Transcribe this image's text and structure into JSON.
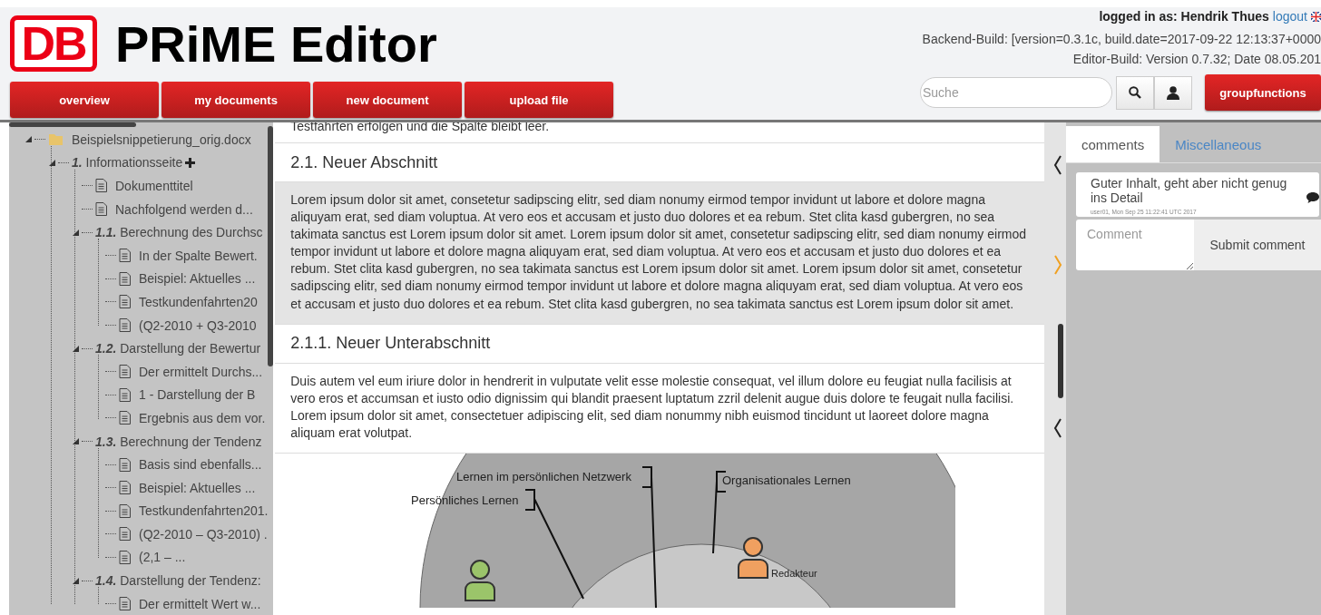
{
  "header": {
    "logo": "DB",
    "title": "PRiME Editor",
    "user_label": "logged in as: Hendrik Thues",
    "logout": "logout",
    "backend_build": "Backend-Build: [version=0.3.1c, build.date=2017-09-22 12:13:37+0000",
    "editor_build": "Editor-Build: Version 0.7.32; Date 08.05.201"
  },
  "nav": [
    {
      "label": "overview"
    },
    {
      "label": "my documents"
    },
    {
      "label": "new document"
    },
    {
      "label": "upload file"
    }
  ],
  "search": {
    "placeholder": "Suche"
  },
  "group_button": "groupfunctions",
  "tree": [
    {
      "kind": "file",
      "label": "Beispielsnippetierung_orig.docx",
      "expanded": true,
      "children": [
        {
          "kind": "section",
          "number": "1.",
          "label": "Informationsseite",
          "expanded": true,
          "children": [
            {
              "kind": "doc",
              "label": "Dokumenttitel"
            },
            {
              "kind": "doc",
              "label": "Nachfolgend werden d..."
            },
            {
              "kind": "section",
              "number": "1.1.",
              "label": "Berechnung des Durchsc",
              "expanded": true,
              "children": [
                {
                  "kind": "doc",
                  "label": "In der Spalte Bewert."
                },
                {
                  "kind": "doc",
                  "label": "Beispiel: Aktuelles ..."
                },
                {
                  "kind": "doc",
                  "label": "Testkundenfahrten20"
                },
                {
                  "kind": "doc",
                  "label": "(Q2-2010 + Q3-2010"
                }
              ]
            },
            {
              "kind": "section",
              "number": "1.2.",
              "label": "Darstellung der Bewertur",
              "expanded": true,
              "children": [
                {
                  "kind": "doc",
                  "label": "Der ermittelt Durchs..."
                },
                {
                  "kind": "doc",
                  "label": " 1 - Darstellung der B"
                },
                {
                  "kind": "doc",
                  "label": "Ergebnis aus dem vor."
                }
              ]
            },
            {
              "kind": "section",
              "number": "1.3.",
              "label": "Berechnung der Tendenz",
              "expanded": true,
              "children": [
                {
                  "kind": "doc",
                  "label": "Basis sind ebenfalls..."
                },
                {
                  "kind": "doc",
                  "label": "Beispiel: Aktuelles ..."
                },
                {
                  "kind": "doc",
                  "label": "Testkundenfahrten201."
                },
                {
                  "kind": "doc",
                  "label": "(Q2-2010 – Q3-2010) ."
                },
                {
                  "kind": "doc",
                  "label": "(2,1 – ..."
                }
              ]
            },
            {
              "kind": "section",
              "number": "1.4.",
              "label": "Darstellung der Tendenz:",
              "expanded": true,
              "children": [
                {
                  "kind": "doc",
                  "label": "Der ermittelt Wert w..."
                }
              ]
            }
          ]
        }
      ]
    }
  ],
  "content": {
    "cut_text": "Testfahrten erfolgen und die Spalte bleibt leer.",
    "blocks": [
      {
        "kind": "heading",
        "text": "2.1. Neuer Abschnitt",
        "selected": false
      },
      {
        "kind": "paragraph",
        "selected": true,
        "text": "Lorem ipsum dolor sit amet, consetetur sadipscing elitr, sed diam nonumy eirmod tempor invidunt ut labore et dolore magna aliquyam erat, sed diam voluptua. At vero eos et accusam et justo duo dolores et ea rebum. Stet clita kasd gubergren, no sea takimata sanctus est Lorem ipsum dolor sit amet. Lorem ipsum dolor sit amet, consetetur sadipscing elitr, sed diam nonumy eirmod tempor invidunt ut labore et dolore magna aliquyam erat, sed diam voluptua. At vero eos et accusam et justo duo dolores et ea rebum. Stet clita kasd gubergren, no sea takimata sanctus est Lorem ipsum dolor sit amet. Lorem ipsum dolor sit amet, consetetur sadipscing elitr, sed diam nonumy eirmod tempor invidunt ut labore et dolore magna aliquyam erat, sed diam voluptua. At vero eos et accusam et justo duo dolores et ea rebum. Stet clita kasd gubergren, no sea takimata sanctus est Lorem ipsum dolor sit amet."
      },
      {
        "kind": "heading",
        "text": "2.1.1. Neuer Unterabschnitt",
        "selected": false
      },
      {
        "kind": "paragraph",
        "selected": false,
        "text": "Duis autem vel eum iriure dolor in hendrerit in vulputate velit esse molestie consequat, vel illum dolore eu feugiat nulla facilisis at vero eros et accumsan et iusto odio dignissim qui blandit praesent luptatum zzril delenit augue duis dolore te feugait nulla facilisi. Lorem ipsum dolor sit amet, consectetuer adipiscing elit, sed diam nonummy nibh euismod tincidunt ut laoreet dolore magna aliquam erat volutpat."
      },
      {
        "kind": "figure",
        "labels": [
          "Lernen im persönlichen Netzwerk",
          "Organisationales Lernen",
          "Persönliches Lernen"
        ],
        "role": "Redakteur"
      }
    ]
  },
  "sidebar": {
    "tabs": [
      {
        "label": "comments",
        "selected": true
      },
      {
        "label": "Miscellaneous",
        "selected": false
      }
    ],
    "comments": [
      {
        "text": "Guter Inhalt, geht aber nicht genug ins Detail",
        "meta": "user01, Mon Sep 25 11:22:41 UTC 2017"
      }
    ],
    "comment_field": {
      "placeholder": "Comment"
    },
    "submit": "Submit comment"
  }
}
